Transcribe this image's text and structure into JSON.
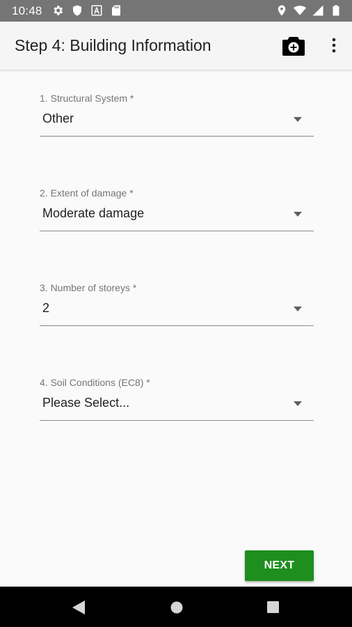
{
  "status_bar": {
    "time": "10:48",
    "left_icons": [
      "settings-icon",
      "shield-icon",
      "a-box-icon",
      "sd-card-icon"
    ],
    "right_icons": [
      "location-icon",
      "wifi-icon",
      "signal-icon",
      "battery-icon"
    ]
  },
  "app_bar": {
    "title": "Step 4: Building Information",
    "actions": [
      "camera-add-icon",
      "more-vert-icon"
    ]
  },
  "form": {
    "fields": [
      {
        "label": "1. Structural System *",
        "value": "Other"
      },
      {
        "label": "2. Extent of damage *",
        "value": "Moderate damage"
      },
      {
        "label": "3. Number of storeys *",
        "value": "2"
      },
      {
        "label": "4. Soil Conditions (EC8) *",
        "value": "Please Select..."
      }
    ]
  },
  "actions": {
    "next_label": "NEXT"
  },
  "nav_bar": {
    "buttons": [
      "back-icon",
      "home-icon",
      "recents-icon"
    ]
  },
  "colors": {
    "status_bar": "#757575",
    "app_bar": "#f5f5f5",
    "background": "#fafafa",
    "next_button": "#1e8e1e",
    "nav_bar": "#000000"
  }
}
